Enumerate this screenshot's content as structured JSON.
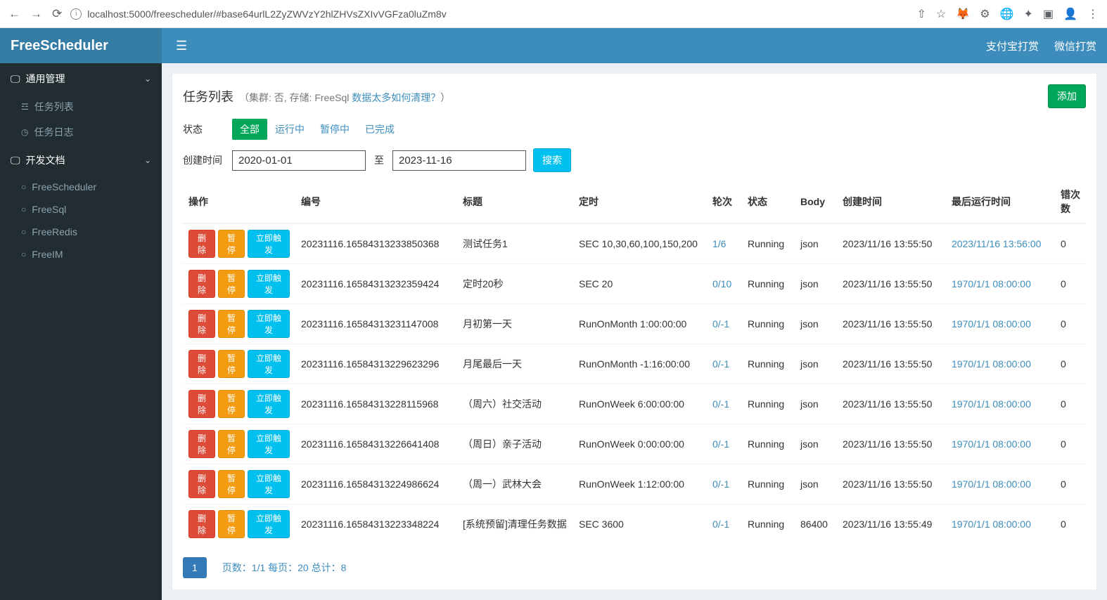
{
  "browser": {
    "url": "localhost:5000/freescheduler/#base64urlL2ZyZWVzY2hlZHVsZXIvVGFza0luZm8v"
  },
  "header": {
    "logo": "FreeScheduler",
    "links": [
      "支付宝打赏",
      "微信打赏"
    ]
  },
  "sidebar": {
    "groups": [
      {
        "label": "通用管理",
        "icon": "monitor",
        "items": [
          {
            "label": "任务列表",
            "icon": "list"
          },
          {
            "label": "任务日志",
            "icon": "clock"
          }
        ]
      },
      {
        "label": "开发文档",
        "icon": "monitor",
        "items": [
          {
            "label": "FreeScheduler",
            "icon": "circle"
          },
          {
            "label": "FreeSql",
            "icon": "circle"
          },
          {
            "label": "FreeRedis",
            "icon": "circle"
          },
          {
            "label": "FreeIM",
            "icon": "circle"
          }
        ]
      }
    ]
  },
  "panel": {
    "title": "任务列表",
    "subtitle_prefix": "（集群: 否, 存储: FreeSql ",
    "subtitle_link": "数据太多如何清理？",
    "subtitle_suffix": "）",
    "add_button": "添加",
    "filters": {
      "status_label": "状态",
      "status_tabs": [
        "全部",
        "运行中",
        "暂停中",
        "已完成"
      ],
      "status_active": 0,
      "date_label": "创建时间",
      "date_from": "2020-01-01",
      "to": "至",
      "date_to": "2023-11-16",
      "search": "搜索"
    },
    "columns": [
      "操作",
      "编号",
      "标题",
      "定时",
      "轮次",
      "状态",
      "Body",
      "创建时间",
      "最后运行时间",
      "错次数"
    ],
    "actions": {
      "delete": "删除",
      "pause": "暂停",
      "trigger": "立即触发"
    },
    "rows": [
      {
        "id": "20231116.16584313233850368",
        "title": "测试任务1",
        "timing": "SEC 10,30,60,100,150,200",
        "round": "1/6",
        "status": "Running",
        "body": "json",
        "created": "2023/11/16 13:55:50",
        "last_run": "2023/11/16 13:56:00",
        "errors": "0"
      },
      {
        "id": "20231116.16584313232359424",
        "title": "定时20秒",
        "timing": "SEC 20",
        "round": "0/10",
        "status": "Running",
        "body": "json",
        "created": "2023/11/16 13:55:50",
        "last_run": "1970/1/1 08:00:00",
        "errors": "0"
      },
      {
        "id": "20231116.16584313231147008",
        "title": "月初第一天",
        "timing": "RunOnMonth 1:00:00:00",
        "round": "0/-1",
        "status": "Running",
        "body": "json",
        "created": "2023/11/16 13:55:50",
        "last_run": "1970/1/1 08:00:00",
        "errors": "0"
      },
      {
        "id": "20231116.16584313229623296",
        "title": "月尾最后一天",
        "timing": "RunOnMonth -1:16:00:00",
        "round": "0/-1",
        "status": "Running",
        "body": "json",
        "created": "2023/11/16 13:55:50",
        "last_run": "1970/1/1 08:00:00",
        "errors": "0"
      },
      {
        "id": "20231116.16584313228115968",
        "title": "（周六）社交活动",
        "timing": "RunOnWeek 6:00:00:00",
        "round": "0/-1",
        "status": "Running",
        "body": "json",
        "created": "2023/11/16 13:55:50",
        "last_run": "1970/1/1 08:00:00",
        "errors": "0"
      },
      {
        "id": "20231116.16584313226641408",
        "title": "（周日）亲子活动",
        "timing": "RunOnWeek 0:00:00:00",
        "round": "0/-1",
        "status": "Running",
        "body": "json",
        "created": "2023/11/16 13:55:50",
        "last_run": "1970/1/1 08:00:00",
        "errors": "0"
      },
      {
        "id": "20231116.16584313224986624",
        "title": "（周一）武林大会",
        "timing": "RunOnWeek 1:12:00:00",
        "round": "0/-1",
        "status": "Running",
        "body": "json",
        "created": "2023/11/16 13:55:50",
        "last_run": "1970/1/1 08:00:00",
        "errors": "0"
      },
      {
        "id": "20231116.16584313223348224",
        "title": "[系统预留]清理任务数据",
        "timing": "SEC 3600",
        "round": "0/-1",
        "status": "Running",
        "body": "86400",
        "created": "2023/11/16 13:55:49",
        "last_run": "1970/1/1 08:00:00",
        "errors": "0"
      }
    ],
    "pager": {
      "current": "1",
      "info": "页数：1/1 每页：20 总计：8"
    }
  }
}
